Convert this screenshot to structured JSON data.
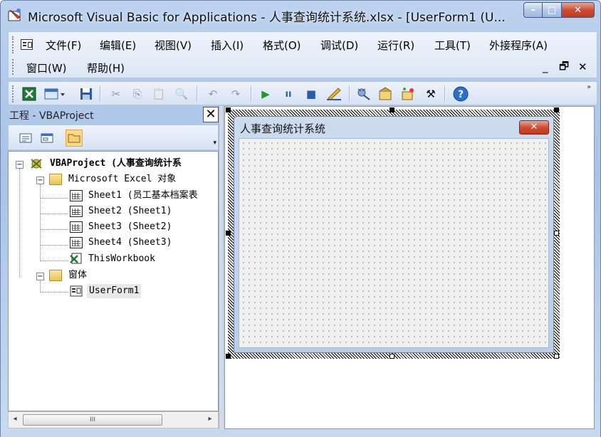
{
  "window": {
    "title": "Microsoft Visual Basic for Applications - 人事查询统计系统.xlsx - [UserForm1 (U...",
    "controls": {
      "minimize": "–",
      "maximize": "□",
      "close": "✕"
    }
  },
  "menubar": {
    "row1": [
      "文件(F)",
      "编辑(E)",
      "视图(V)",
      "插入(I)",
      "格式(O)",
      "调试(D)",
      "运行(R)",
      "工具(T)",
      "外接程序(A)"
    ],
    "row2": [
      "窗口(W)",
      "帮助(H)"
    ],
    "mdi": {
      "minimize": "_",
      "restore": "🗗",
      "close": "✕"
    }
  },
  "toolbar": {
    "icons": [
      "excel-view-icon",
      "insert-userform-icon",
      "save-icon",
      "cut-icon",
      "copy-icon",
      "paste-icon",
      "find-icon",
      "undo-icon",
      "redo-icon",
      "run-icon",
      "break-icon",
      "reset-icon",
      "design-mode-icon",
      "project-explorer-icon",
      "properties-icon",
      "object-browser-icon",
      "toolbox-icon",
      "help-icon"
    ],
    "overflow": "»"
  },
  "project": {
    "title": "工程 - VBAProject",
    "close": "✕",
    "tree": {
      "root": "VBAProject (人事查询统计系",
      "excel_folder": "Microsoft Excel 对象",
      "sheets": [
        "Sheet1 (员工基本档案表",
        "Sheet2 (Sheet1)",
        "Sheet3 (Sheet2)",
        "Sheet4 (Sheet3)"
      ],
      "workbook": "ThisWorkbook",
      "forms_folder": "窗体",
      "userform": "UserForm1"
    },
    "scroll_thumb": "III"
  },
  "userform": {
    "caption": "人事查询统计系统",
    "close": "✕"
  }
}
